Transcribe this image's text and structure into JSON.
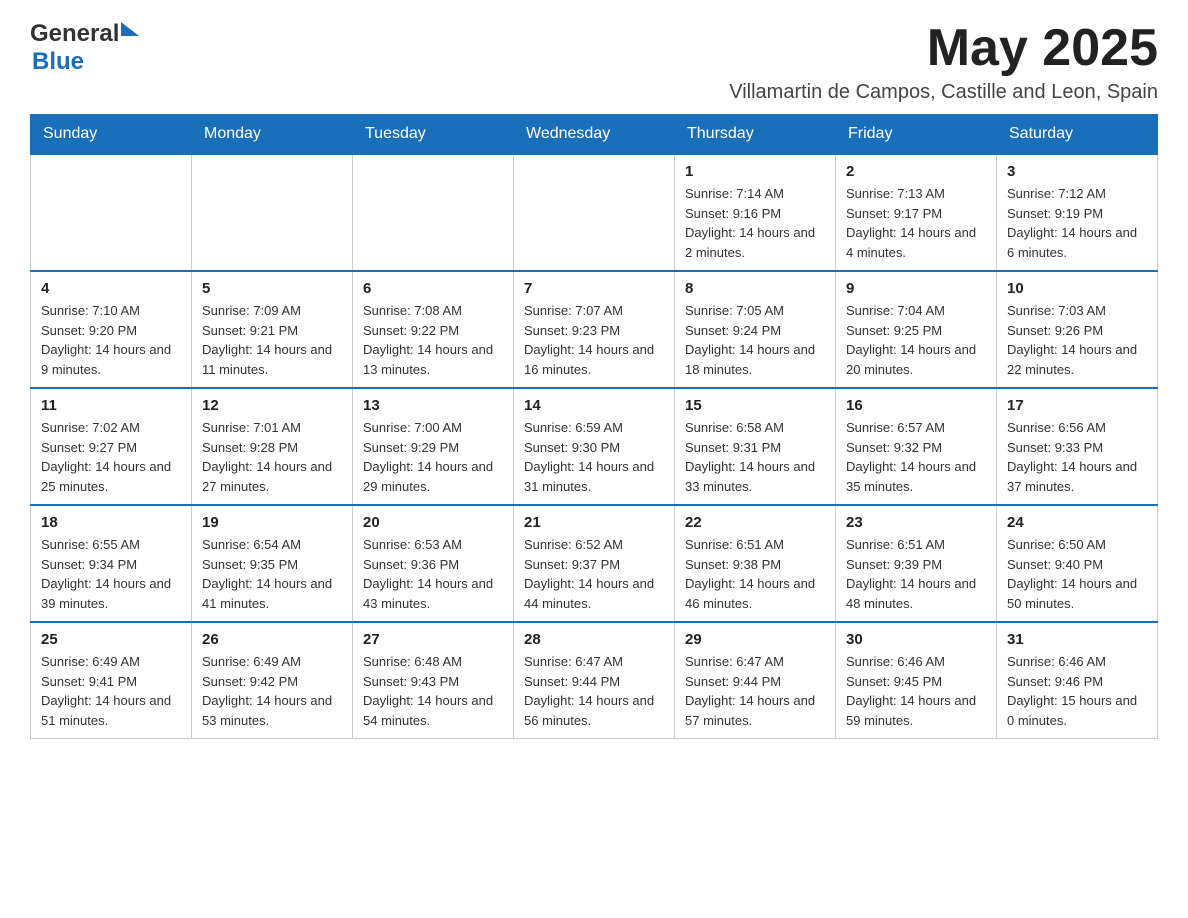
{
  "header": {
    "month_year": "May 2025",
    "location": "Villamartin de Campos, Castille and Leon, Spain",
    "logo_general": "General",
    "logo_blue": "Blue"
  },
  "days_of_week": [
    "Sunday",
    "Monday",
    "Tuesday",
    "Wednesday",
    "Thursday",
    "Friday",
    "Saturday"
  ],
  "weeks": [
    {
      "days": [
        {
          "number": "",
          "info": ""
        },
        {
          "number": "",
          "info": ""
        },
        {
          "number": "",
          "info": ""
        },
        {
          "number": "",
          "info": ""
        },
        {
          "number": "1",
          "info": "Sunrise: 7:14 AM\nSunset: 9:16 PM\nDaylight: 14 hours and 2 minutes."
        },
        {
          "number": "2",
          "info": "Sunrise: 7:13 AM\nSunset: 9:17 PM\nDaylight: 14 hours and 4 minutes."
        },
        {
          "number": "3",
          "info": "Sunrise: 7:12 AM\nSunset: 9:19 PM\nDaylight: 14 hours and 6 minutes."
        }
      ]
    },
    {
      "days": [
        {
          "number": "4",
          "info": "Sunrise: 7:10 AM\nSunset: 9:20 PM\nDaylight: 14 hours and 9 minutes."
        },
        {
          "number": "5",
          "info": "Sunrise: 7:09 AM\nSunset: 9:21 PM\nDaylight: 14 hours and 11 minutes."
        },
        {
          "number": "6",
          "info": "Sunrise: 7:08 AM\nSunset: 9:22 PM\nDaylight: 14 hours and 13 minutes."
        },
        {
          "number": "7",
          "info": "Sunrise: 7:07 AM\nSunset: 9:23 PM\nDaylight: 14 hours and 16 minutes."
        },
        {
          "number": "8",
          "info": "Sunrise: 7:05 AM\nSunset: 9:24 PM\nDaylight: 14 hours and 18 minutes."
        },
        {
          "number": "9",
          "info": "Sunrise: 7:04 AM\nSunset: 9:25 PM\nDaylight: 14 hours and 20 minutes."
        },
        {
          "number": "10",
          "info": "Sunrise: 7:03 AM\nSunset: 9:26 PM\nDaylight: 14 hours and 22 minutes."
        }
      ]
    },
    {
      "days": [
        {
          "number": "11",
          "info": "Sunrise: 7:02 AM\nSunset: 9:27 PM\nDaylight: 14 hours and 25 minutes."
        },
        {
          "number": "12",
          "info": "Sunrise: 7:01 AM\nSunset: 9:28 PM\nDaylight: 14 hours and 27 minutes."
        },
        {
          "number": "13",
          "info": "Sunrise: 7:00 AM\nSunset: 9:29 PM\nDaylight: 14 hours and 29 minutes."
        },
        {
          "number": "14",
          "info": "Sunrise: 6:59 AM\nSunset: 9:30 PM\nDaylight: 14 hours and 31 minutes."
        },
        {
          "number": "15",
          "info": "Sunrise: 6:58 AM\nSunset: 9:31 PM\nDaylight: 14 hours and 33 minutes."
        },
        {
          "number": "16",
          "info": "Sunrise: 6:57 AM\nSunset: 9:32 PM\nDaylight: 14 hours and 35 minutes."
        },
        {
          "number": "17",
          "info": "Sunrise: 6:56 AM\nSunset: 9:33 PM\nDaylight: 14 hours and 37 minutes."
        }
      ]
    },
    {
      "days": [
        {
          "number": "18",
          "info": "Sunrise: 6:55 AM\nSunset: 9:34 PM\nDaylight: 14 hours and 39 minutes."
        },
        {
          "number": "19",
          "info": "Sunrise: 6:54 AM\nSunset: 9:35 PM\nDaylight: 14 hours and 41 minutes."
        },
        {
          "number": "20",
          "info": "Sunrise: 6:53 AM\nSunset: 9:36 PM\nDaylight: 14 hours and 43 minutes."
        },
        {
          "number": "21",
          "info": "Sunrise: 6:52 AM\nSunset: 9:37 PM\nDaylight: 14 hours and 44 minutes."
        },
        {
          "number": "22",
          "info": "Sunrise: 6:51 AM\nSunset: 9:38 PM\nDaylight: 14 hours and 46 minutes."
        },
        {
          "number": "23",
          "info": "Sunrise: 6:51 AM\nSunset: 9:39 PM\nDaylight: 14 hours and 48 minutes."
        },
        {
          "number": "24",
          "info": "Sunrise: 6:50 AM\nSunset: 9:40 PM\nDaylight: 14 hours and 50 minutes."
        }
      ]
    },
    {
      "days": [
        {
          "number": "25",
          "info": "Sunrise: 6:49 AM\nSunset: 9:41 PM\nDaylight: 14 hours and 51 minutes."
        },
        {
          "number": "26",
          "info": "Sunrise: 6:49 AM\nSunset: 9:42 PM\nDaylight: 14 hours and 53 minutes."
        },
        {
          "number": "27",
          "info": "Sunrise: 6:48 AM\nSunset: 9:43 PM\nDaylight: 14 hours and 54 minutes."
        },
        {
          "number": "28",
          "info": "Sunrise: 6:47 AM\nSunset: 9:44 PM\nDaylight: 14 hours and 56 minutes."
        },
        {
          "number": "29",
          "info": "Sunrise: 6:47 AM\nSunset: 9:44 PM\nDaylight: 14 hours and 57 minutes."
        },
        {
          "number": "30",
          "info": "Sunrise: 6:46 AM\nSunset: 9:45 PM\nDaylight: 14 hours and 59 minutes."
        },
        {
          "number": "31",
          "info": "Sunrise: 6:46 AM\nSunset: 9:46 PM\nDaylight: 15 hours and 0 minutes."
        }
      ]
    }
  ]
}
